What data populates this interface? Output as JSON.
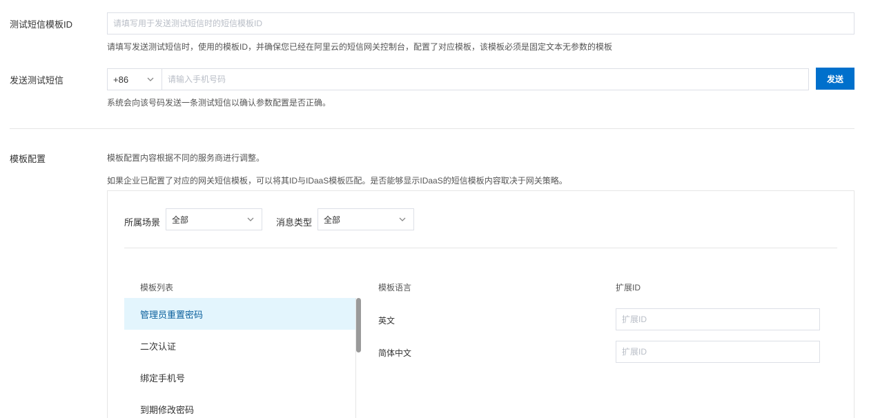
{
  "test_template": {
    "label": "测试短信模板ID",
    "placeholder": "请填写用于发送测试短信时的短信模板ID",
    "help": "请填写发送测试短信时，使用的模板ID，并确保您已经在阿里云的短信网关控制台，配置了对应模板，该模板必须是固定文本无参数的模板"
  },
  "send_test": {
    "label": "发送测试短信",
    "country_code": "+86",
    "phone_placeholder": "请输入手机号码",
    "send_button": "发送",
    "help": "系统会向该号码发送一条测试短信以确认参数配置是否正确。"
  },
  "template_config": {
    "label": "模板配置",
    "desc1": "模板配置内容根据不同的服务商进行调整。",
    "desc2": "如果企业已配置了对应的网关短信模板，可以将其ID与IDaaS模板匹配。是否能够显示IDaaS的短信模板内容取决于网关策略。",
    "filters": {
      "scene_label": "所属场景",
      "scene_value": "全部",
      "type_label": "消息类型",
      "type_value": "全部"
    },
    "columns": {
      "list": "模板列表",
      "language": "模板语言",
      "ext_id": "扩展ID"
    },
    "templates": [
      {
        "name": "管理员重置密码",
        "active": true
      },
      {
        "name": "二次认证",
        "active": false
      },
      {
        "name": "绑定手机号",
        "active": false
      },
      {
        "name": "到期修改密码",
        "active": false
      }
    ],
    "languages": [
      {
        "name": "英文",
        "ext_placeholder": "扩展ID"
      },
      {
        "name": "简体中文",
        "ext_placeholder": "扩展ID"
      }
    ]
  },
  "colors": {
    "primary": "#0070cc",
    "active_bg": "#e3f5fd",
    "active_text": "#0a5f9c"
  }
}
